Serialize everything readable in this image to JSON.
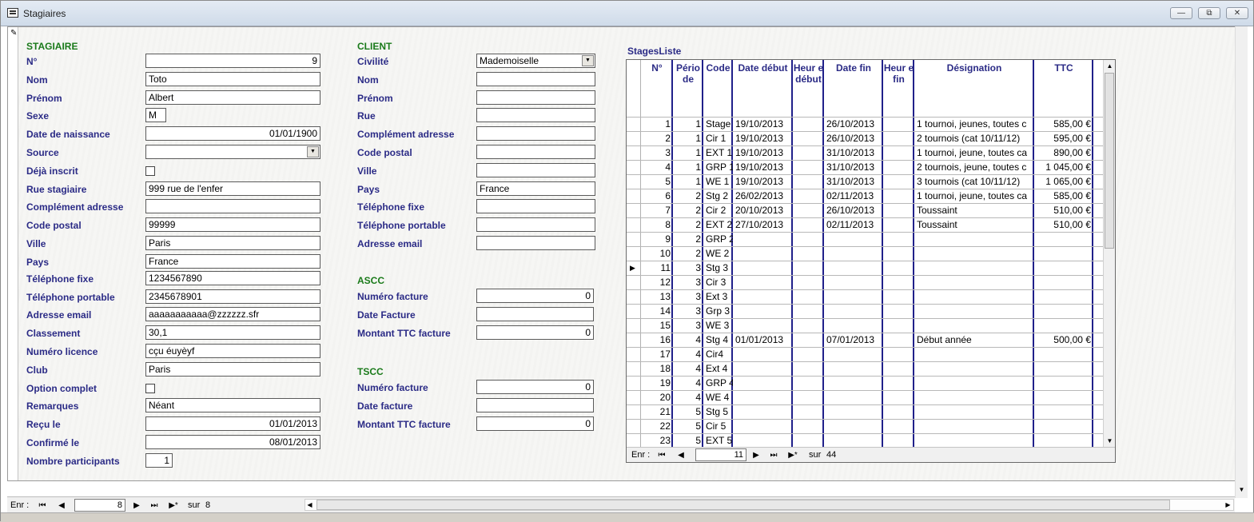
{
  "window": {
    "title": "Stagiaires",
    "controls": [
      "—",
      "⧉",
      "✕"
    ]
  },
  "stagiaire": {
    "header": "STAGIAIRE",
    "fields": [
      {
        "label": "N°",
        "value": "9",
        "align": "right",
        "type": "text"
      },
      {
        "label": "Nom",
        "value": "Toto",
        "type": "text"
      },
      {
        "label": "Prénom",
        "value": "Albert",
        "type": "text"
      },
      {
        "label": "Sexe",
        "value": "M",
        "type": "short"
      },
      {
        "label": "Date de naissance",
        "value": "01/01/1900",
        "align": "right",
        "type": "text"
      },
      {
        "label": "Source",
        "value": "",
        "type": "combo"
      },
      {
        "label": "Déjà inscrit",
        "value": "",
        "type": "check"
      },
      {
        "label": "Rue stagiaire",
        "value": "999 rue de l'enfer",
        "type": "text"
      },
      {
        "label": "Complément adresse",
        "value": "",
        "type": "text"
      },
      {
        "label": "Code postal",
        "value": "99999",
        "type": "text"
      },
      {
        "label": "Ville",
        "value": "Paris",
        "type": "text"
      },
      {
        "label": "Pays",
        "value": "France",
        "type": "text"
      },
      {
        "label": "Téléphone fixe",
        "value": "1234567890",
        "type": "text"
      },
      {
        "label": "Téléphone portable",
        "value": "2345678901",
        "type": "text"
      },
      {
        "label": "Adresse email",
        "value": "aaaaaaaaaaa@zzzzzz.sfr",
        "type": "text"
      },
      {
        "label": "Classement",
        "value": "30,1",
        "type": "text"
      },
      {
        "label": "Numéro licence",
        "value": "cçu éuyèyf",
        "type": "text"
      },
      {
        "label": "Club",
        "value": "Paris",
        "type": "text"
      },
      {
        "label": "Option complet",
        "value": "",
        "type": "check"
      },
      {
        "label": "Remarques",
        "value": "Néant",
        "type": "text"
      },
      {
        "label": "Reçu le",
        "value": "01/01/2013",
        "align": "right",
        "type": "text"
      },
      {
        "label": "Confirmé le",
        "value": "08/01/2013",
        "align": "right",
        "type": "text"
      },
      {
        "label": "Nombre participants",
        "value": "1",
        "align": "right",
        "type": "short"
      }
    ]
  },
  "client": {
    "header": "CLIENT",
    "fields": [
      {
        "label": "Civilité",
        "value": "Mademoiselle",
        "type": "combo"
      },
      {
        "label": "Nom",
        "value": ""
      },
      {
        "label": "Prénom",
        "value": ""
      },
      {
        "label": "Rue",
        "value": ""
      },
      {
        "label": "Complément adresse",
        "value": ""
      },
      {
        "label": "Code postal",
        "value": ""
      },
      {
        "label": "Ville",
        "value": ""
      },
      {
        "label": "Pays",
        "value": "France"
      },
      {
        "label": "Téléphone fixe",
        "value": ""
      },
      {
        "label": "Téléphone portable",
        "value": ""
      },
      {
        "label": "Adresse email",
        "value": ""
      }
    ]
  },
  "ascc": {
    "header": "ASCC",
    "fields": [
      {
        "label": "Numéro facture",
        "value": "0",
        "align": "right"
      },
      {
        "label": "Date Facture",
        "value": ""
      },
      {
        "label": "Montant TTC facture",
        "value": "0",
        "align": "right"
      }
    ]
  },
  "tscc": {
    "header": "TSCC",
    "fields": [
      {
        "label": "Numéro facture",
        "value": "0",
        "align": "right"
      },
      {
        "label": "Date facture",
        "value": ""
      },
      {
        "label": "Montant TTC facture",
        "value": "0",
        "align": "right"
      }
    ]
  },
  "stages": {
    "title": "StagesListe",
    "columns": [
      "N°",
      "Pério de",
      "Code",
      "Date début",
      "Heur e début",
      "Date fin",
      "Heur e fin",
      "Désignation",
      "TTC"
    ],
    "current_row_marker": "▶",
    "rows": [
      [
        "1",
        "1",
        "Stage",
        "19/10/2013",
        "",
        "26/10/2013",
        "",
        "1 tournoi, jeunes, toutes c",
        "585,00 €"
      ],
      [
        "2",
        "1",
        "Cir 1",
        "19/10/2013",
        "",
        "26/10/2013",
        "",
        "2 tournois (cat 10/11/12)",
        "595,00 €"
      ],
      [
        "3",
        "1",
        "EXT 1",
        "19/10/2013",
        "",
        "31/10/2013",
        "",
        "1 tournoi, jeune, toutes ca",
        "890,00 €"
      ],
      [
        "4",
        "1",
        "GRP 1",
        "19/10/2013",
        "",
        "31/10/2013",
        "",
        "2 tournois, jeune, toutes c",
        "1 045,00 €"
      ],
      [
        "5",
        "1",
        "WE 1",
        "19/10/2013",
        "",
        "31/10/2013",
        "",
        "3 tournois (cat 10/11/12)",
        "1 065,00 €"
      ],
      [
        "6",
        "2",
        "Stg 2",
        "26/02/2013",
        "",
        "02/11/2013",
        "",
        "1 tournoi, jeune, toutes ca",
        "585,00 €"
      ],
      [
        "7",
        "2",
        "Cir 2",
        "20/10/2013",
        "",
        "26/10/2013",
        "",
        "Toussaint",
        "510,00 €"
      ],
      [
        "8",
        "2",
        "EXT 2",
        "27/10/2013",
        "",
        "02/11/2013",
        "",
        "Toussaint",
        "510,00 €"
      ],
      [
        "9",
        "2",
        "GRP 2",
        "",
        "",
        "",
        "",
        "",
        ""
      ],
      [
        "10",
        "2",
        "WE 2",
        "",
        "",
        "",
        "",
        "",
        ""
      ],
      [
        "11",
        "3",
        "Stg 3",
        "",
        "",
        "",
        "",
        "",
        ""
      ],
      [
        "12",
        "3",
        "Cir 3",
        "",
        "",
        "",
        "",
        "",
        ""
      ],
      [
        "13",
        "3",
        "Ext 3",
        "",
        "",
        "",
        "",
        "",
        ""
      ],
      [
        "14",
        "3",
        "Grp 3",
        "",
        "",
        "",
        "",
        "",
        ""
      ],
      [
        "15",
        "3",
        "WE 3",
        "",
        "",
        "",
        "",
        "",
        ""
      ],
      [
        "16",
        "4",
        "Stg 4",
        "01/01/2013",
        "",
        "07/01/2013",
        "",
        "Début année",
        "500,00 €"
      ],
      [
        "17",
        "4",
        "Cir4",
        "",
        "",
        "",
        "",
        "",
        ""
      ],
      [
        "18",
        "4",
        "Ext 4",
        "",
        "",
        "",
        "",
        "",
        ""
      ],
      [
        "19",
        "4",
        "GRP 4",
        "",
        "",
        "",
        "",
        "",
        ""
      ],
      [
        "20",
        "4",
        "WE 4",
        "",
        "",
        "",
        "",
        "",
        ""
      ],
      [
        "21",
        "5",
        "Stg 5",
        "",
        "",
        "",
        "",
        "",
        ""
      ],
      [
        "22",
        "5",
        "Cir 5",
        "",
        "",
        "",
        "",
        "",
        ""
      ],
      [
        "23",
        "5",
        "EXT 5",
        "",
        "",
        "",
        "",
        "",
        ""
      ]
    ],
    "current_row": 11,
    "nav": {
      "label": "Enr :",
      "current": "11",
      "of_label": "sur",
      "total": "44"
    }
  },
  "form_nav": {
    "label": "Enr :",
    "current": "8",
    "of_label": "sur",
    "total": "8"
  },
  "nav_glyphs": {
    "first": "⏮",
    "prev": "◀",
    "next": "▶",
    "last": "⏭",
    "new": "▶*"
  },
  "scroll_glyphs": {
    "up": "▲",
    "down": "▼",
    "left": "◀",
    "right": "▶"
  }
}
